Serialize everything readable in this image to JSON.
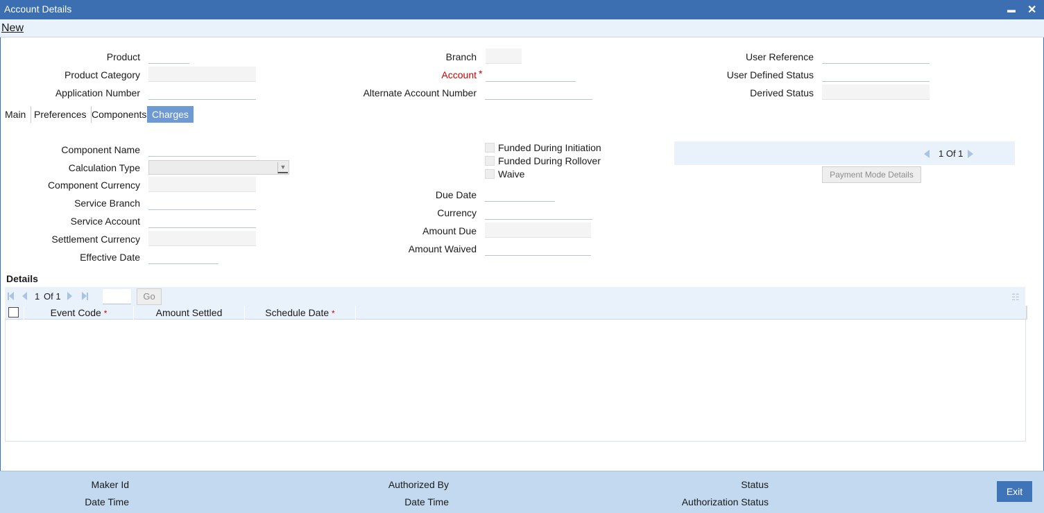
{
  "window": {
    "title": "Account Details",
    "minimize": "▬",
    "close": "✕"
  },
  "menu": {
    "new_label": "New"
  },
  "header_fields": {
    "product": "Product",
    "product_category": "Product Category",
    "application_number": "Application Number",
    "branch": "Branch",
    "account": "Account",
    "alternate_account_number": "Alternate Account Number",
    "user_reference": "User Reference",
    "user_defined_status": "User Defined Status",
    "derived_status": "Derived Status"
  },
  "tabs": [
    "Main",
    "Preferences",
    "Components",
    "Charges"
  ],
  "charges": {
    "component_name": "Component Name",
    "calculation_type": "Calculation Type",
    "component_currency": "Component Currency",
    "service_branch": "Service Branch",
    "service_account": "Service Account",
    "settlement_currency": "Settlement Currency",
    "effective_date": "Effective Date",
    "funded_during_initiation": "Funded During Initiation",
    "funded_during_rollover": "Funded During Rollover",
    "waive": "Waive",
    "due_date": "Due Date",
    "currency": "Currency",
    "amount_due": "Amount Due",
    "amount_waived": "Amount Waived",
    "pager": "1 Of 1",
    "payment_mode_button": "Payment Mode Details"
  },
  "details": {
    "title": "Details",
    "pager": "1",
    "pager_of": "Of 1",
    "go_label": "Go",
    "columns": [
      "Event Code",
      "Amount Settled",
      "Schedule Date"
    ],
    "required_star": "*"
  },
  "footer": {
    "maker_id": "Maker Id",
    "date_time_1": "Date Time",
    "authorized_by": "Authorized By",
    "date_time_2": "Date Time",
    "status": "Status",
    "authorization_status": "Authorization Status",
    "exit_label": "Exit"
  }
}
